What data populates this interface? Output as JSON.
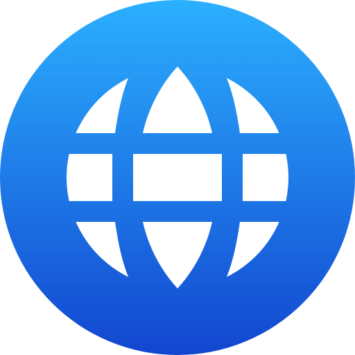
{
  "icon": {
    "name": "globe-icon",
    "colors": {
      "gradient_top": "#2BB0FF",
      "gradient_bottom": "#1246D0",
      "glyph": "#FFFFFF"
    }
  }
}
